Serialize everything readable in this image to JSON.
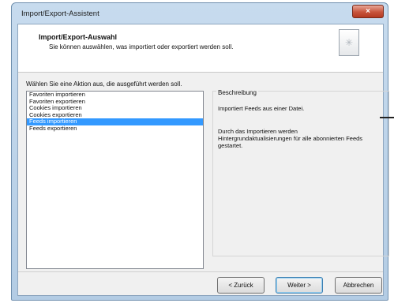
{
  "window": {
    "title": "Import/Export-Assistent",
    "close_label": "×"
  },
  "header": {
    "title": "Import/Export-Auswahl",
    "subtitle": "Sie können auswählen, was importiert oder exportiert werden soll.",
    "icon": "wizard-page-icon"
  },
  "main": {
    "prompt": "Wählen Sie eine Aktion aus, die ausgeführt werden soll.",
    "actions": [
      "Favoriten importieren",
      "Favoriten exportieren",
      "Cookies importieren",
      "Cookies exportieren",
      "Feeds importieren",
      "Feeds exportieren"
    ],
    "selected_action": "Feeds importieren"
  },
  "description": {
    "title": "Beschreibung",
    "line1": "Importiert Feeds aus einer Datei.",
    "line2": "Durch das Importieren werden Hintergrundaktualisierungen für alle abonnierten Feeds gestartet."
  },
  "buttons": {
    "back": "< Zurück",
    "next": "Weiter >",
    "cancel": "Abbrechen"
  },
  "colors": {
    "selection": "#3399ff",
    "titlebar": "#c7dbee",
    "close": "#c8543c"
  }
}
